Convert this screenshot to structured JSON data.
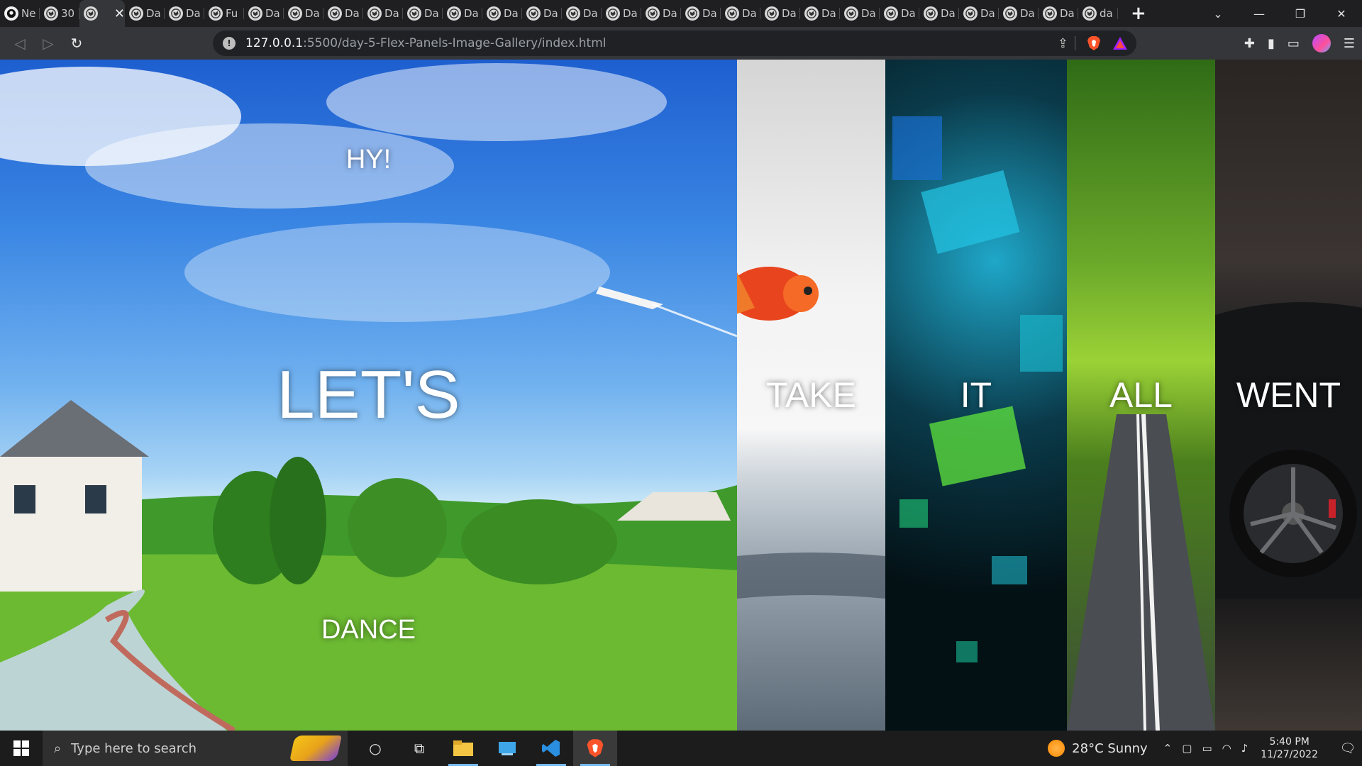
{
  "browser": {
    "tabs": [
      {
        "label": "Ne",
        "icon": "github-icon"
      },
      {
        "label": "30",
        "icon": "globe-icon"
      },
      {
        "label": "",
        "icon": "globe-icon",
        "active": true
      },
      {
        "label": "Da",
        "icon": "globe-icon"
      },
      {
        "label": "Da",
        "icon": "globe-icon"
      },
      {
        "label": "Fu",
        "icon": "globe-icon"
      },
      {
        "label": "Da",
        "icon": "globe-icon"
      },
      {
        "label": "Da",
        "icon": "globe-icon"
      },
      {
        "label": "Da",
        "icon": "globe-icon"
      },
      {
        "label": "Da",
        "icon": "globe-icon"
      },
      {
        "label": "Da",
        "icon": "globe-icon"
      },
      {
        "label": "Da",
        "icon": "globe-icon"
      },
      {
        "label": "Da",
        "icon": "globe-icon"
      },
      {
        "label": "Da",
        "icon": "globe-icon"
      },
      {
        "label": "Da",
        "icon": "globe-icon"
      },
      {
        "label": "Da",
        "icon": "globe-icon"
      },
      {
        "label": "Da",
        "icon": "globe-icon"
      },
      {
        "label": "Da",
        "icon": "globe-icon"
      },
      {
        "label": "Da",
        "icon": "globe-icon"
      },
      {
        "label": "Da",
        "icon": "globe-icon"
      },
      {
        "label": "Da",
        "icon": "globe-icon"
      },
      {
        "label": "Da",
        "icon": "globe-icon"
      },
      {
        "label": "Da",
        "icon": "globe-icon"
      },
      {
        "label": "Da",
        "icon": "globe-icon"
      },
      {
        "label": "Da",
        "icon": "globe-icon"
      },
      {
        "label": "Da",
        "icon": "globe-icon"
      },
      {
        "label": "Da",
        "icon": "globe-icon"
      },
      {
        "label": "da",
        "icon": "globe-icon"
      }
    ],
    "url_host": "127.0.0.1",
    "url_rest": ":5500/day-5-Flex-Panels-Image-Gallery/index.html"
  },
  "panels": [
    {
      "top": "HY!",
      "mid": "LET'S",
      "bottom": "DANCE"
    },
    {
      "top": "",
      "mid": "TAKE",
      "bottom": ""
    },
    {
      "top": "",
      "mid": "IT",
      "bottom": ""
    },
    {
      "top": "",
      "mid": "ALL",
      "bottom": ""
    },
    {
      "top": "",
      "mid": "WENT",
      "bottom": ""
    }
  ],
  "taskbar": {
    "search_placeholder": "Type here to search",
    "weather": "28°C  Sunny",
    "time": "5:40 PM",
    "date": "11/27/2022"
  },
  "colors": {
    "chrome_bg": "#35363a",
    "tabstrip_bg": "#1f1f22",
    "taskbar_bg": "#1c1c1c",
    "taskbar_accent": "#76b9ed"
  }
}
